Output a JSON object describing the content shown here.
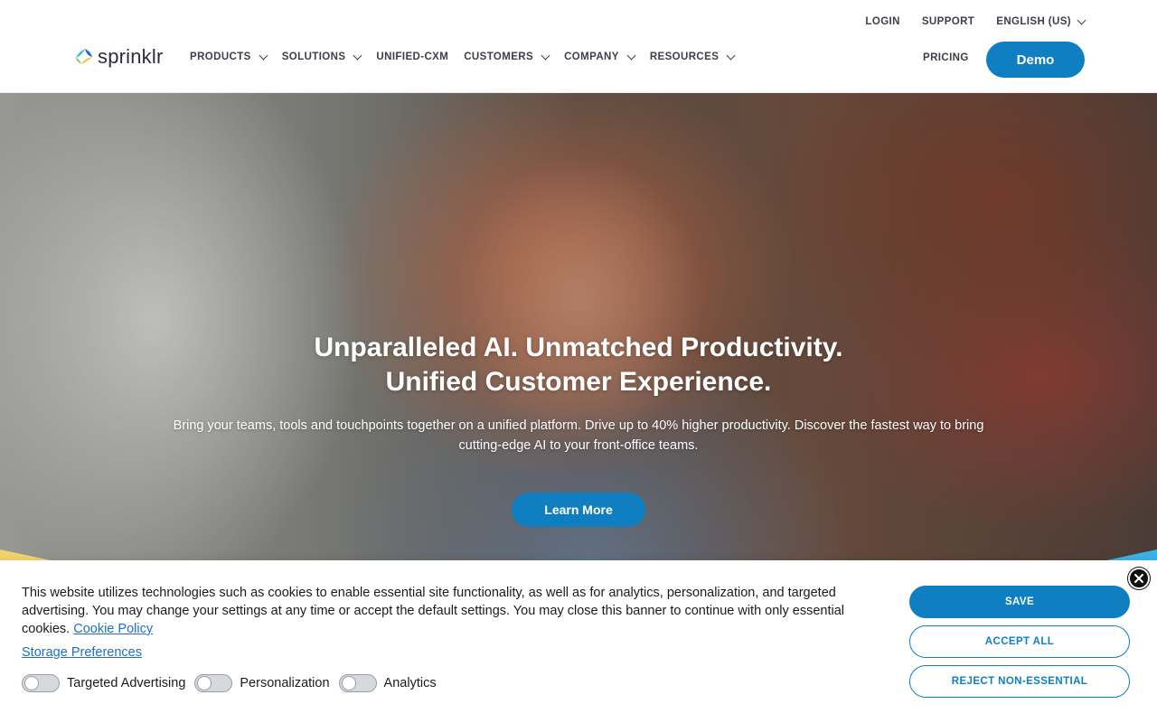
{
  "header": {
    "utility": [
      {
        "label": "LOGIN",
        "has_dropdown": false
      },
      {
        "label": "SUPPORT",
        "has_dropdown": false
      },
      {
        "label": "ENGLISH (US)",
        "has_dropdown": true
      }
    ],
    "logo_text": "sprinklr",
    "nav": [
      {
        "label": "PRODUCTS",
        "has_dropdown": true
      },
      {
        "label": "SOLUTIONS",
        "has_dropdown": true
      },
      {
        "label": "UNIFIED-CXM",
        "has_dropdown": false
      },
      {
        "label": "CUSTOMERS",
        "has_dropdown": true
      },
      {
        "label": "COMPANY",
        "has_dropdown": true
      },
      {
        "label": "RESOURCES",
        "has_dropdown": true
      }
    ],
    "pricing_label": "PRICING",
    "demo_label": "Demo"
  },
  "hero": {
    "title_line1": "Unparalleled AI. Unmatched Productivity.",
    "title_line2": "Unified Customer Experience.",
    "subtitle": "Bring your teams, tools and touchpoints together on a unified platform. Drive up to 40% higher productivity. Discover the fastest way to bring cutting-edge AI to your front-office teams.",
    "cta_label": "Learn More"
  },
  "cookie": {
    "text": "This website utilizes technologies such as cookies to enable essential site functionality, as well as for analytics, personalization, and targeted advertising. You may change your settings at any time or accept the default settings. You may close this banner to continue with only essential cookies.",
    "policy_link": "Cookie Policy",
    "storage_link": "Storage Preferences",
    "toggles": [
      {
        "label": "Targeted Advertising",
        "on": false
      },
      {
        "label": "Personalization",
        "on": false
      },
      {
        "label": "Analytics",
        "on": false
      }
    ],
    "save_label": "SAVE",
    "accept_label": "ACCEPT ALL",
    "reject_label": "REJECT NON-ESSENTIAL"
  },
  "colors": {
    "brand_blue": "#0f7fc2",
    "link_blue": "#1f6fc5"
  }
}
